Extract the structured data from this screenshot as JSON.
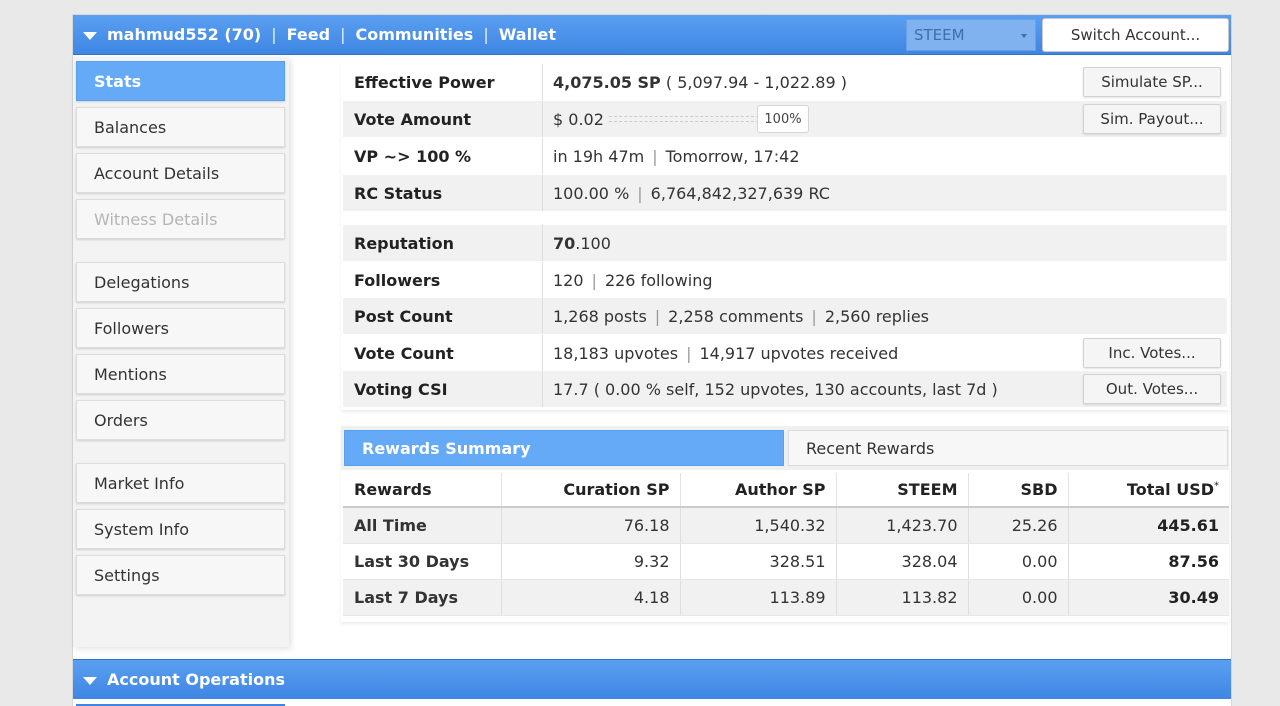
{
  "header": {
    "account_label": "mahmud552 (70)",
    "sep": "|",
    "links": [
      "Feed",
      "Communities",
      "Wallet"
    ],
    "token_select": "STEEM",
    "switch_account": "Switch Account..."
  },
  "sidebar": {
    "items": [
      {
        "label": "Stats"
      },
      {
        "label": "Balances"
      },
      {
        "label": "Account Details"
      },
      {
        "label": "Witness Details"
      },
      {
        "label": "Delegations"
      },
      {
        "label": "Followers"
      },
      {
        "label": "Mentions"
      },
      {
        "label": "Orders"
      },
      {
        "label": "Market Info"
      },
      {
        "label": "System Info"
      },
      {
        "label": "Settings"
      }
    ]
  },
  "stats": {
    "effective_power": {
      "label": "Effective Power",
      "value_bold": "4,075.05 SP",
      "value_rest": " ( 5,097.94 - 1,022.89 )",
      "button": "Simulate SP..."
    },
    "vote_amount": {
      "label": "Vote Amount",
      "value": "$ 0.02",
      "percent": "100%",
      "slider_level": 1.0,
      "button": "Sim. Payout..."
    },
    "vp": {
      "label": "VP ~> 100 %",
      "value1": "in 19h 47m",
      "value2": "Tomorrow, 17:42"
    },
    "rc_status": {
      "label": "RC Status",
      "value1": "100.00 %",
      "value2": "6,764,842,327,639 RC"
    },
    "reputation": {
      "label": "Reputation",
      "value_bold": "70",
      "value_rest": ".100"
    },
    "followers": {
      "label": "Followers",
      "value1": "120",
      "value2": "226 following"
    },
    "post_count": {
      "label": "Post Count",
      "value1": "1,268 posts",
      "value2": "2,258 comments",
      "value3": "2,560 replies"
    },
    "vote_count": {
      "label": "Vote Count",
      "value1": "18,183 upvotes",
      "value2": "14,917 upvotes received",
      "button": "Inc. Votes..."
    },
    "voting_csi": {
      "label": "Voting CSI",
      "value": "17.7 ( 0.00 % self, 152 upvotes, 130 accounts, last 7d )",
      "button": "Out. Votes..."
    }
  },
  "rewards": {
    "tabs": [
      "Rewards Summary",
      "Recent Rewards"
    ],
    "columns": [
      "Rewards",
      "Curation SP",
      "Author SP",
      "STEEM",
      "SBD",
      "Total USD"
    ],
    "total_usd_mark": "*",
    "rows": [
      {
        "period": "All Time",
        "curation": "76.18",
        "author": "1,540.32",
        "steem": "1,423.70",
        "sbd": "25.26",
        "total": "445.61"
      },
      {
        "period": "Last 30 Days",
        "curation": "9.32",
        "author": "328.51",
        "steem": "328.04",
        "sbd": "0.00",
        "total": "87.56"
      },
      {
        "period": "Last 7 Days",
        "curation": "4.18",
        "author": "113.89",
        "steem": "113.82",
        "sbd": "0.00",
        "total": "30.49"
      }
    ]
  },
  "operations": {
    "title": "Account Operations"
  }
}
